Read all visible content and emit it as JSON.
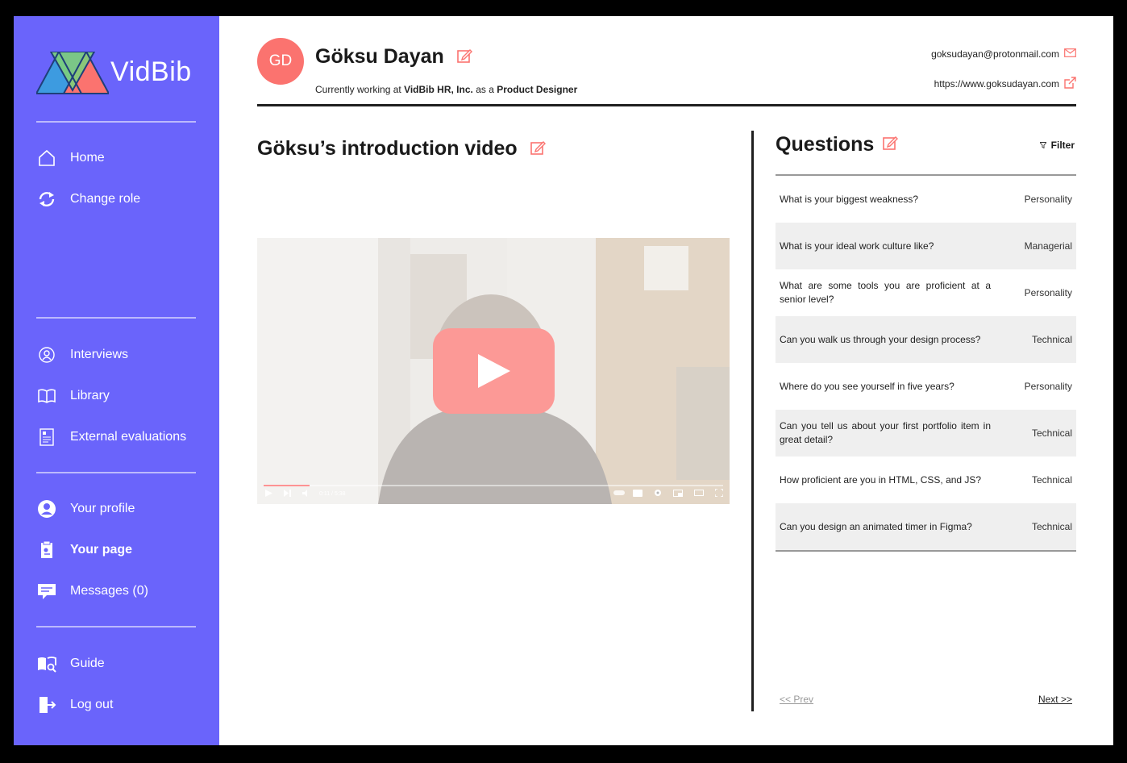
{
  "app": {
    "name": "VidBib"
  },
  "sidebar": {
    "items": [
      {
        "label": "Home",
        "icon": "home-icon"
      },
      {
        "label": "Change role",
        "icon": "refresh-icon"
      },
      {
        "label": "Interviews",
        "icon": "interviews-icon"
      },
      {
        "label": "Library",
        "icon": "book-icon"
      },
      {
        "label": "External evaluations",
        "icon": "evaluation-doc-icon"
      },
      {
        "label": "Your profile",
        "icon": "user-circle-icon"
      },
      {
        "label": "Your page",
        "icon": "page-icon",
        "active": true
      },
      {
        "label": "Messages (0)",
        "icon": "message-icon"
      },
      {
        "label": "Guide",
        "icon": "guide-icon"
      },
      {
        "label": "Log out",
        "icon": "logout-icon"
      }
    ]
  },
  "profile": {
    "initials": "GD",
    "name": "Göksu Dayan",
    "working_prefix": "Currently working at",
    "company": "VidBib HR, Inc.",
    "as_text": "as a",
    "role": "Product Designer",
    "email": "goksudayan@protonmail.com",
    "website": "https://www.goksudayan.com"
  },
  "video": {
    "title": "Göksu’s introduction video",
    "time": "0:11 / 5:38",
    "progress": 0.1
  },
  "questions": {
    "title": "Questions",
    "filter_label": "Filter",
    "items": [
      {
        "text": "What is your biggest weakness?",
        "category": "Personality"
      },
      {
        "text": "What is your ideal work culture like?",
        "category": "Managerial"
      },
      {
        "text": "What are some tools  you are proficient at a senior level?",
        "category": "Personality"
      },
      {
        "text": "Can you walk us through your design process?",
        "category": "Technical"
      },
      {
        "text": "Where do you see yourself in five years?",
        "category": "Personality"
      },
      {
        "text": "Can you tell us about your first portfolio item in great detail?",
        "category": "Technical"
      },
      {
        "text": "How proficient are you in HTML, CSS, and JS?",
        "category": "Technical"
      },
      {
        "text": "Can you design an animated timer in Figma?",
        "category": "Technical"
      }
    ],
    "prev_label": "<< Prev",
    "next_label": "Next >>"
  },
  "colors": {
    "sidebar": "#6a64fb",
    "accent": "#fb736f",
    "text": "#1a1a1a"
  }
}
